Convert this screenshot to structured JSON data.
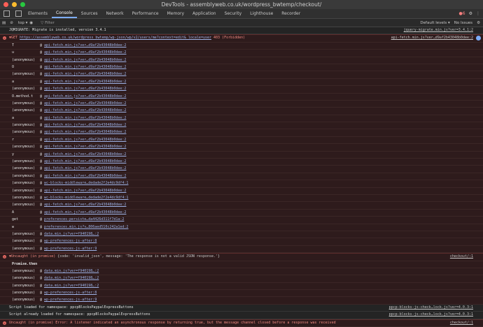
{
  "window": {
    "title": "DevTools - assemblyweb.co.uk/wordpress_bwtemp/checkout/"
  },
  "tabs": [
    "Elements",
    "Console",
    "Sources",
    "Network",
    "Performance",
    "Memory",
    "Application",
    "Security",
    "Lighthouse",
    "Recorder"
  ],
  "toolbar": {
    "error_count": "6",
    "context": "top",
    "filter_placeholder": "Filter",
    "levels": "Default levels",
    "issues": "No Issues"
  },
  "info_line": {
    "text": "JQMIGRATE: Migrate is installed, version 3.4.1",
    "source": "jquery-migrate.min.js?ver=3.4.1:2"
  },
  "get_error": {
    "method": "GET",
    "url": "https://assemblyweb.co.uk/wordpress_bwtemp/wp-json/wp/v2/users/me?context=edit&_locale=user",
    "status": "403 (Forbidden)",
    "source": "api-fetch.min.js?ver…d9af2b43048b0dee:2"
  },
  "stack1": [
    {
      "fn": "T",
      "link": "api-fetch.min.js?ver…d9af2b43048b0dee:2"
    },
    {
      "fn": "u",
      "link": "api-fetch.min.js?ver…d9af2b43048b0dee:2"
    },
    {
      "fn": "(anonymous)",
      "link": "api-fetch.min.js?ver…d9af2b43048b0dee:2"
    },
    {
      "fn": "O",
      "link": "api-fetch.min.js?ver…d9af2b43048b0dee:2"
    },
    {
      "fn": "(anonymous)",
      "link": "api-fetch.min.js?ver…d9af2b43048b0dee:2"
    },
    {
      "fn": "a",
      "link": "api-fetch.min.js?ver…d9af2b43048b0dee:2"
    },
    {
      "fn": "(anonymous)",
      "link": "api-fetch.min.js?ver…d9af2b43048b0dee:2"
    },
    {
      "fn": "O.method.t",
      "link": "api-fetch.min.js?ver…d9af2b43048b0dee:2"
    },
    {
      "fn": "(anonymous)",
      "link": "api-fetch.min.js?ver…d9af2b43048b0dee:2"
    },
    {
      "fn": "(anonymous)",
      "link": "api-fetch.min.js?ver…d9af2b43048b0dee:2"
    },
    {
      "fn": "a",
      "link": "api-fetch.min.js?ver…d9af2b43048b0dee:2"
    },
    {
      "fn": "(anonymous)",
      "link": "api-fetch.min.js?ver…d9af2b43048b0dee:2"
    },
    {
      "fn": "(anonymous)",
      "link": "api-fetch.min.js?ver…d9af2b43048b0dee:2"
    },
    {
      "fn": "r",
      "link": "api-fetch.min.js?ver…d9af2b43048b0dee:2"
    },
    {
      "fn": "(anonymous)",
      "link": "api-fetch.min.js?ver…d9af2b43048b0dee:2"
    },
    {
      "fn": "y",
      "link": "api-fetch.min.js?ver…d9af2b43048b0dee:2"
    },
    {
      "fn": "(anonymous)",
      "link": "api-fetch.min.js?ver…d9af2b43048b0dee:2"
    },
    {
      "fn": "(anonymous)",
      "link": "api-fetch.min.js?ver…d9af2b43048b0dee:2"
    },
    {
      "fn": "(anonymous)",
      "link": "api-fetch.min.js?ver…d9af2b43048b0dee:2"
    },
    {
      "fn": "(anonymous)",
      "link": "wc-blocks-middleware…dedade2f2e4dc9df4:1"
    },
    {
      "fn": "(anonymous)",
      "link": "api-fetch.min.js?ver…d9af2b43048b0dee:2"
    },
    {
      "fn": "(anonymous)",
      "link": "wc-blocks-middleware…dedade2f2e4dc9df4:1"
    },
    {
      "fn": "(anonymous)",
      "link": "api-fetch.min.js?ver…d9af2b43048b0dee:2"
    },
    {
      "fn": "A",
      "link": "api-fetch.min.js?ver…d9af2b43048b0dee:2"
    },
    {
      "fn": "get",
      "link": "preferences-persiste…da4426d311f7d1a:2"
    },
    {
      "fn": "w",
      "link": "preferences.min.js?v…806aed510c242a1ed:2"
    },
    {
      "fn": "(anonymous)",
      "link": "data.min.js?ver=f940198…:2"
    },
    {
      "fn": "(anonymous)",
      "link": "wp-preferences-js-after:8"
    },
    {
      "fn": "(anonymous)",
      "link": "wp-preferences-js-after:9"
    }
  ],
  "uncaught1": {
    "prefix": "▼Uncaught (in promise)",
    "detail": "{code: 'invalid_json', message: 'The response is not a valid JSON response.'}",
    "source": "checkout/:1",
    "promise_then": "Promise.then"
  },
  "stack2": [
    {
      "fn": "(anonymous)",
      "link": "data.min.js?ver=f940198…:2"
    },
    {
      "fn": "(anonymous)",
      "link": "data.min.js?ver=f940198…:2"
    },
    {
      "fn": "(anonymous)",
      "link": "data.min.js?ver=f940198…:2"
    },
    {
      "fn": "(anonymous)",
      "link": "wp-preferences-js-after:8"
    },
    {
      "fn": "(anonymous)",
      "link": "wp-preferences-js-after:9"
    }
  ],
  "script_lines": [
    {
      "text": "Script loaded for namespace: ppcpBlocksPaypalExpressButtons",
      "source": "ppcp-blocks-js-check…lock.js?ver=4.0.3:1"
    },
    {
      "text": "Script already loaded for namespace: ppcpBlocksPaypalExpressButtons",
      "source": "ppcp-blocks-js-check…lock.js?ver=4.0.3:1"
    }
  ],
  "last_error": {
    "text": "Uncaught (in promise) Error: A listener indicated an asynchronous response by returning true, but the message channel closed before a response was received",
    "source": "checkout/:1"
  },
  "colors": {
    "error_bg": "#2e1b1c",
    "link": "#9fb4e8",
    "error_text": "#f28b82"
  }
}
